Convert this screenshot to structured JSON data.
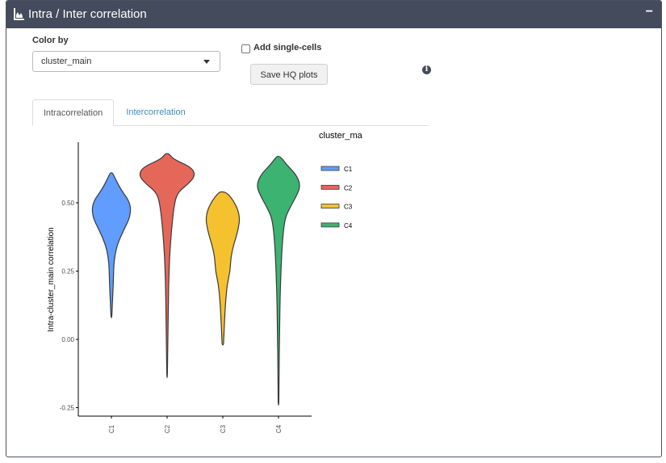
{
  "header": {
    "title": "Intra / Inter correlation",
    "collapse_label": "−"
  },
  "controls": {
    "color_by_label": "Color by",
    "color_by_value": "cluster_main",
    "add_single_cells_label": "Add single-cells",
    "add_single_cells_checked": false,
    "save_button_label": "Save HQ plots",
    "info_icon_glyph": "i"
  },
  "tabs": [
    {
      "label": "Intracorrelation",
      "active": true
    },
    {
      "label": "Intercorrelation",
      "active": false
    }
  ],
  "chart_data": {
    "type": "violin",
    "ylabel": "Intra-cluster_main correlation",
    "xlabel": "",
    "legend_title": "cluster_ma",
    "legend_position": "right",
    "y_ticks": [
      "0.50",
      "0.25",
      "0.00",
      "-0.25"
    ],
    "y_tick_values": [
      0.5,
      0.25,
      0.0,
      -0.25
    ],
    "categories": [
      "C1",
      "C2",
      "C3",
      "C4"
    ],
    "colors": [
      "#619cff",
      "#e5675a",
      "#f5c12f",
      "#3cb371"
    ],
    "series": [
      {
        "name": "C1",
        "min": 0.08,
        "max": 0.61,
        "density": [
          [
            0.61,
            0.02
          ],
          [
            0.59,
            0.06
          ],
          [
            0.55,
            0.15
          ],
          [
            0.5,
            0.31
          ],
          [
            0.45,
            0.31
          ],
          [
            0.4,
            0.2
          ],
          [
            0.35,
            0.1
          ],
          [
            0.3,
            0.05
          ],
          [
            0.25,
            0.035
          ],
          [
            0.2,
            0.03
          ],
          [
            0.15,
            0.02
          ],
          [
            0.1,
            0.01
          ],
          [
            0.08,
            0.005
          ]
        ]
      },
      {
        "name": "C2",
        "min": -0.14,
        "max": 0.68,
        "density": [
          [
            0.68,
            0.03
          ],
          [
            0.66,
            0.1
          ],
          [
            0.63,
            0.4
          ],
          [
            0.6,
            0.46
          ],
          [
            0.57,
            0.35
          ],
          [
            0.54,
            0.18
          ],
          [
            0.5,
            0.12
          ],
          [
            0.4,
            0.07
          ],
          [
            0.3,
            0.04
          ],
          [
            0.2,
            0.025
          ],
          [
            0.1,
            0.02
          ],
          [
            0.0,
            0.012
          ],
          [
            -0.1,
            0.006
          ],
          [
            -0.14,
            0.004
          ]
        ]
      },
      {
        "name": "C3",
        "min": -0.02,
        "max": 0.54,
        "density": [
          [
            0.54,
            0.06
          ],
          [
            0.5,
            0.2
          ],
          [
            0.45,
            0.28
          ],
          [
            0.4,
            0.25
          ],
          [
            0.35,
            0.18
          ],
          [
            0.3,
            0.13
          ],
          [
            0.25,
            0.12
          ],
          [
            0.2,
            0.07
          ],
          [
            0.15,
            0.05
          ],
          [
            0.1,
            0.035
          ],
          [
            0.05,
            0.025
          ],
          [
            0.0,
            0.015
          ],
          [
            -0.02,
            0.01
          ]
        ]
      },
      {
        "name": "C4",
        "min": -0.24,
        "max": 0.67,
        "density": [
          [
            0.67,
            0.03
          ],
          [
            0.64,
            0.13
          ],
          [
            0.6,
            0.3
          ],
          [
            0.56,
            0.36
          ],
          [
            0.52,
            0.28
          ],
          [
            0.48,
            0.18
          ],
          [
            0.44,
            0.1
          ],
          [
            0.35,
            0.06
          ],
          [
            0.25,
            0.04
          ],
          [
            0.15,
            0.025
          ],
          [
            0.05,
            0.02
          ],
          [
            -0.05,
            0.012
          ],
          [
            -0.15,
            0.008
          ],
          [
            -0.24,
            0.005
          ]
        ]
      }
    ]
  }
}
